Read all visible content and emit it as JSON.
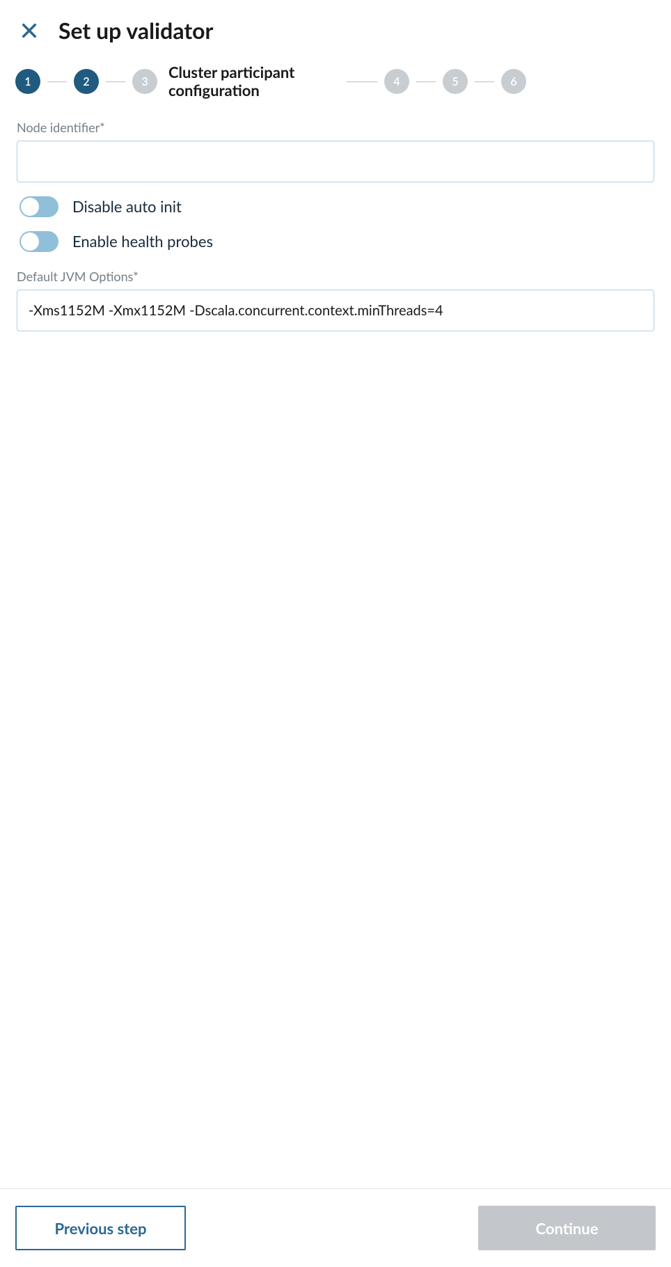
{
  "header": {
    "title": "Set up validator"
  },
  "stepper": {
    "steps": [
      {
        "number": "1",
        "state": "active"
      },
      {
        "number": "2",
        "state": "active"
      },
      {
        "number": "3",
        "state": "inactive",
        "label": "Cluster participant configuration"
      },
      {
        "number": "4",
        "state": "inactive"
      },
      {
        "number": "5",
        "state": "inactive"
      },
      {
        "number": "6",
        "state": "inactive"
      }
    ]
  },
  "form": {
    "node_identifier": {
      "label": "Node identifier*",
      "value": ""
    },
    "disable_auto_init": {
      "label": "Disable auto init",
      "enabled": false
    },
    "enable_health_probes": {
      "label": "Enable health probes",
      "enabled": false
    },
    "jvm_options": {
      "label": "Default JVM Options*",
      "value": "-Xms1152M -Xmx1152M -Dscala.concurrent.context.minThreads=4"
    }
  },
  "footer": {
    "previous_label": "Previous step",
    "continue_label": "Continue"
  }
}
